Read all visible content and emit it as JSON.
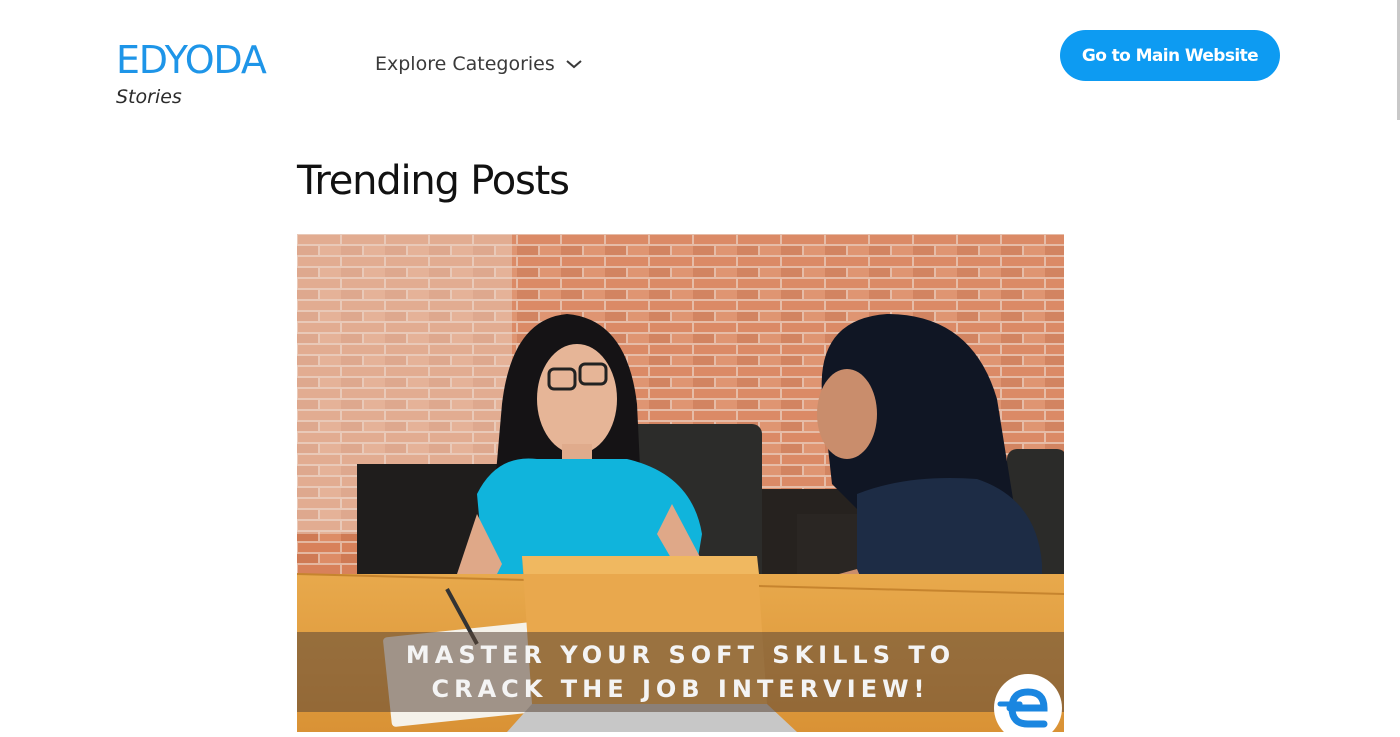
{
  "header": {
    "brand_name": "EDYODA",
    "brand_sub": "Stories",
    "explore_label": "Explore Categories",
    "cta_label": "Go to Main Website"
  },
  "main": {
    "section_title": "Trending Posts",
    "featured_post": {
      "banner_line_1": "MASTER YOUR SOFT SKILLS TO",
      "banner_line_2": "CRACK THE JOB INTERVIEW!",
      "logo_icon": "edyoda-e-logo-icon"
    }
  },
  "colors": {
    "brand": "#1e95e8",
    "cta_bg": "#0d9bf2",
    "brick": "#d8815a"
  },
  "icons": {
    "dropdown": "chevron-down-icon"
  }
}
